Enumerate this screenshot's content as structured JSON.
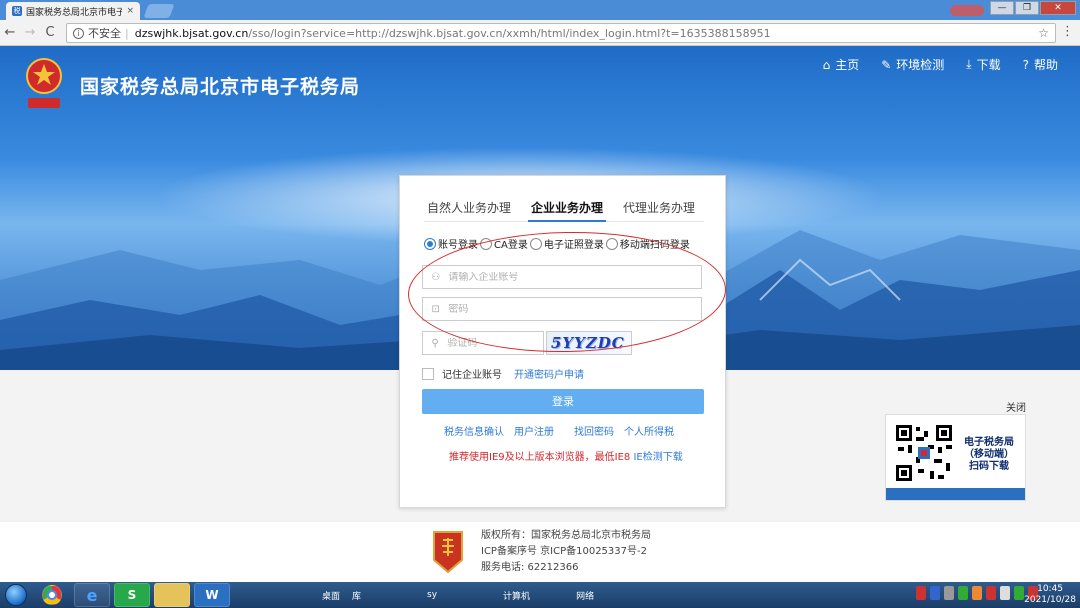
{
  "browser": {
    "tab_title": "国家税务总局北京市电子",
    "tab_close": "×",
    "win_min": "—",
    "win_max": "❐",
    "win_close": "✕",
    "back_icon": "←",
    "forward_icon": "→",
    "reload_icon": "C",
    "info_icon": "i",
    "insecure_label": "不安全",
    "url_host": "dzswjhk.bjsat.gov.cn",
    "url_rest": "/sso/login?service=http://dzswjhk.bjsat.gov.cn/xxmh/html/index_login.html?t=1635388158951",
    "star_icon": "☆",
    "menu_icon": "⋮"
  },
  "header": {
    "site_title": "国家税务总局北京市电子税务局",
    "logo_icon": "national-emblem-icon",
    "nav": [
      {
        "icon": "⌂",
        "label": "主页"
      },
      {
        "icon": "✎",
        "label": "环境检测"
      },
      {
        "icon": "⤓",
        "label": "下载"
      },
      {
        "icon": "?",
        "label": "帮助"
      }
    ]
  },
  "login": {
    "tabs": [
      "自然人业务办理",
      "企业业务办理",
      "代理业务办理"
    ],
    "active_tab": 1,
    "methods": [
      "账号登录",
      "CA登录",
      "电子证照登录",
      "移动端扫码登录"
    ],
    "selected_method": 0,
    "account_placeholder": "请输入企业账号",
    "password_placeholder": "密码",
    "captcha_placeholder": "验证码",
    "captcha_text": "5YYZDC",
    "remember_label": "记住企业账号",
    "apply_link": "开通密码户申请",
    "login_button": "登录",
    "links": [
      "税务信息确认",
      "用户注册",
      "找回密码",
      "个人所得税"
    ],
    "notice": "推荐使用IE9及以上版本浏览器，最低IE8",
    "notice_link": "IE检测下载",
    "user_icon": "⚇",
    "lock_icon": "⊡",
    "search_icon": "⚲"
  },
  "qr_panel": {
    "close": "关闭",
    "line1": "电子税务局",
    "line2": "（移动端）",
    "line3": "扫码下载"
  },
  "footer": {
    "copyright": "版权所有：国家税务总局北京市税务局",
    "icp": "ICP备案序号 京ICP备10025337号-2",
    "phone": "服务电话: 62212366"
  },
  "taskbar": {
    "labels": [
      "桌面",
      "库",
      "sy",
      "计算机",
      "网络"
    ],
    "tasks": [
      "chrome",
      "ie",
      "S",
      "folder",
      "W"
    ],
    "time": "10:45",
    "date": "2021/10/28"
  }
}
